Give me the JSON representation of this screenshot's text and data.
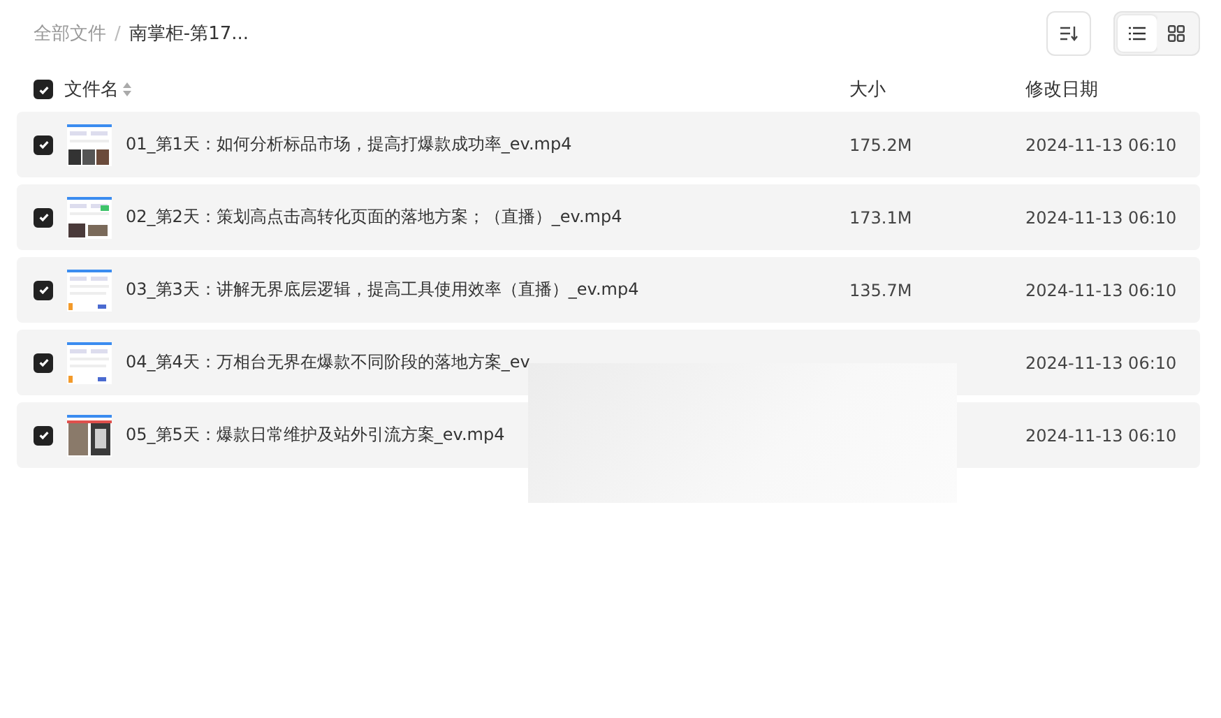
{
  "breadcrumb": [
    {
      "label": "全部文件",
      "current": false
    },
    {
      "label": "南掌柜-第17...",
      "current": true
    }
  ],
  "breadcrumb_separator": "/",
  "toolbar": {
    "view_modes": [
      {
        "kind": "list",
        "selected": true
      },
      {
        "kind": "grid",
        "selected": false
      }
    ]
  },
  "header": {
    "checked": true,
    "columns": [
      "文件名",
      "大小",
      "修改日期"
    ]
  },
  "rows": [
    {
      "checked": true,
      "name": "01_第1天：如何分析标品市场，提高打爆款成功率_ev.mp4",
      "size": "175.2M",
      "date": "2024-11-13 06:10"
    },
    {
      "checked": true,
      "name": "02_第2天：策划高点击高转化页面的落地方案；（直播）_ev.mp4",
      "size": "173.1M",
      "date": "2024-11-13 06:10"
    },
    {
      "checked": true,
      "name": "03_第3天：讲解无界底层逻辑，提高工具使用效率（直播）_ev.mp4",
      "size": "135.7M",
      "date": "2024-11-13 06:10"
    },
    {
      "checked": true,
      "name": "04_第4天：万相台无界在爆款不同阶段的落地方案_ev",
      "date": "2024-11-13 06:10"
    },
    {
      "checked": true,
      "name": "05_第5天：爆款日常维护及站外引流方案_ev.mp4",
      "date": "2024-11-13 06:10"
    }
  ]
}
